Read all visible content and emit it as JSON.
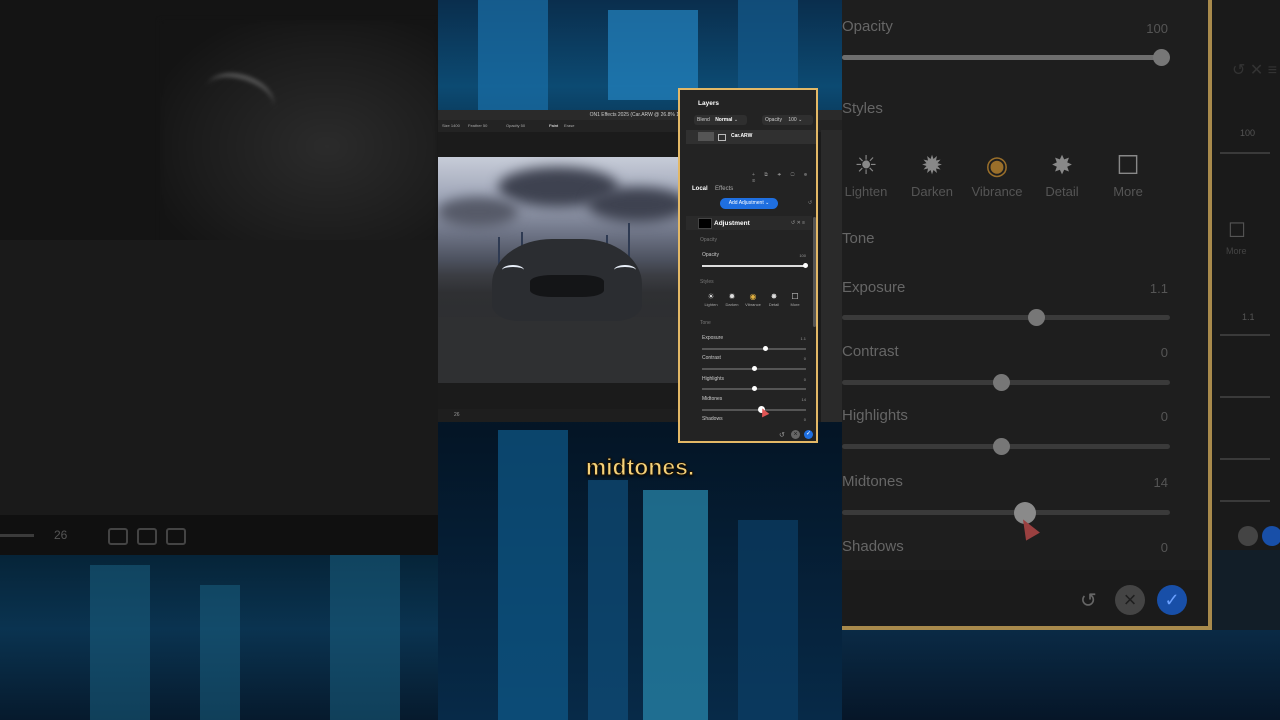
{
  "app": {
    "window_title": "ON1 Effects 2025 (Car.ARW @ 26.8% 16-bit)",
    "toolbar": [
      "Size 1400",
      "Feather 50",
      "Opacity 50",
      "Paint",
      "Erase"
    ],
    "status_zoom": "26"
  },
  "layers_panel": {
    "title": "Layers",
    "blend_label": "Blend",
    "blend_value": "Normal",
    "opacity_label": "Opacity",
    "opacity_value": "100",
    "layer_name": "Car.ARW",
    "tabs": [
      "Local",
      "Effects"
    ],
    "add_adjustment": "Add Adjustment",
    "adjustment_title": "Adjustment",
    "section_opacity": "Opacity",
    "opacity_slider": {
      "label": "Opacity",
      "value": "100",
      "level": 1.0
    },
    "section_styles": "Styles",
    "styles": [
      {
        "label": "Lighten",
        "icon": "sun-icon"
      },
      {
        "label": "Darken",
        "icon": "dark-sun-icon"
      },
      {
        "label": "Vibrance",
        "icon": "color-wheel-icon"
      },
      {
        "label": "Detail",
        "icon": "sparkle-icon"
      },
      {
        "label": "More",
        "icon": "dropdown-box-icon"
      }
    ],
    "section_tone": "Tone",
    "sliders": [
      {
        "label": "Exposure",
        "value": "1.1",
        "level": 0.6
      },
      {
        "label": "Contrast",
        "value": "0",
        "level": 0.5
      },
      {
        "label": "Highlights",
        "value": "0",
        "level": 0.5
      },
      {
        "label": "Midtones",
        "value": "14",
        "level": 0.57
      },
      {
        "label": "Shadows",
        "value": "0",
        "level": 0.5
      }
    ]
  },
  "caption": "midtones.",
  "zoom_panel": {
    "opacity_label": "Opacity",
    "opacity_value": "100",
    "styles_label": "Styles",
    "tone_label": "Tone",
    "styles": [
      "Lighten",
      "Darken",
      "Vibrance",
      "Detail",
      "More"
    ],
    "sliders": [
      {
        "label": "Exposure",
        "value": "1.1"
      },
      {
        "label": "Contrast",
        "value": "0"
      },
      {
        "label": "Highlights",
        "value": "0"
      },
      {
        "label": "Midtones",
        "value": "14"
      },
      {
        "label": "Shadows",
        "value": "0"
      }
    ],
    "right_column": {
      "value_top": "100",
      "value_1": "1.1",
      "more_label": "More"
    }
  },
  "colors": {
    "accent": "#1f6fe0",
    "highlight_border": "#e3b866",
    "caption": "#f5d27a"
  }
}
